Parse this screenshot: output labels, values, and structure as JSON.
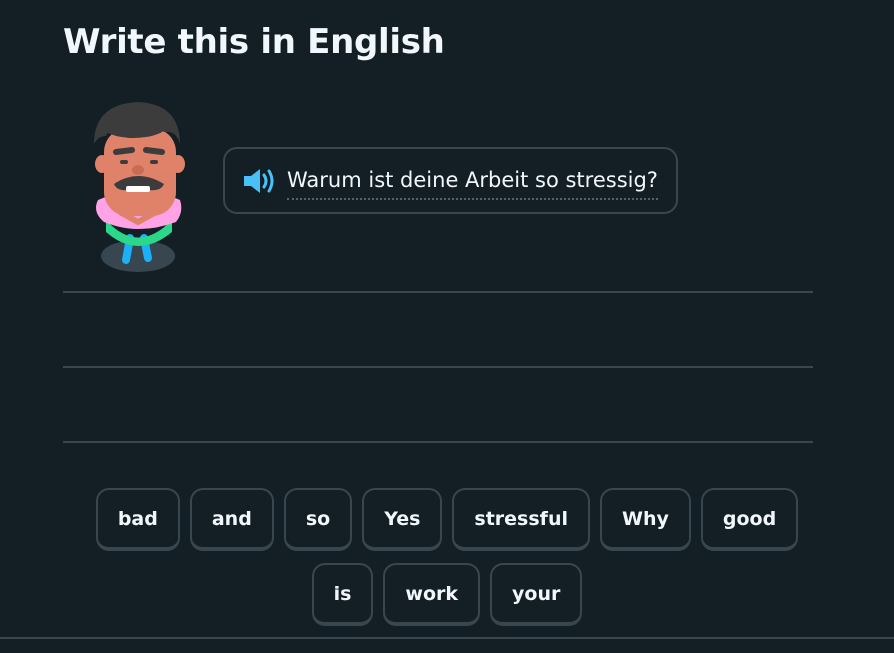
{
  "prompt": {
    "title": "Write this in English"
  },
  "bubble": {
    "sentence": "Warum ist deine Arbeit so stressig?",
    "speaker_icon": "speaker-icon"
  },
  "word_bank": {
    "row1": [
      "bad",
      "and",
      "so",
      "Yes",
      "stressful",
      "Why",
      "good"
    ],
    "row2": [
      "is",
      "work",
      "your"
    ]
  },
  "colors": {
    "background": "#131f24",
    "border": "#37464f",
    "text": "#f1f7fb",
    "speaker": "#49c0f8"
  }
}
